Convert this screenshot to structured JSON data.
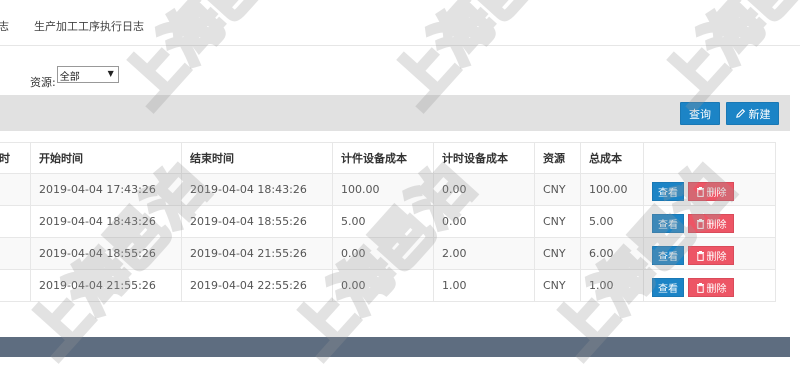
{
  "tabs": [
    {
      "label": "志"
    },
    {
      "label": "生产加工工序执行日志"
    }
  ],
  "filter": {
    "label": "资源:",
    "selected": "全部"
  },
  "toolbar": {
    "query_label": "查询",
    "new_label": "新建"
  },
  "table": {
    "headers": [
      "时",
      "开始时间",
      "结束时间",
      "计件设备成本",
      "计时设备成本",
      "资源",
      "总成本",
      ""
    ],
    "rows": [
      {
        "start": "2019-04-04 17:43:26",
        "end": "2019-04-04 18:43:26",
        "piece_cost": "100.00",
        "time_cost": "0.00",
        "resource": "CNY",
        "total": "100.00"
      },
      {
        "start": "2019-04-04 18:43:26",
        "end": "2019-04-04 18:55:26",
        "piece_cost": "5.00",
        "time_cost": "0.00",
        "resource": "CNY",
        "total": "5.00"
      },
      {
        "start": "2019-04-04 18:55:26",
        "end": "2019-04-04 21:55:26",
        "piece_cost": "0.00",
        "time_cost": "2.00",
        "resource": "CNY",
        "total": "6.00"
      },
      {
        "start": "2019-04-04 21:55:26",
        "end": "2019-04-04 22:55:26",
        "piece_cost": "0.00",
        "time_cost": "1.00",
        "resource": "CNY",
        "total": "1.00"
      }
    ],
    "view_label": "查看",
    "delete_label": "删除"
  },
  "watermark": {
    "text": "上海邑泊"
  },
  "colors": {
    "primary": "#1c84c6",
    "danger": "#ed5565",
    "toolbar_bg": "#e1e1e1",
    "footer_bar": "#5e6d80"
  }
}
